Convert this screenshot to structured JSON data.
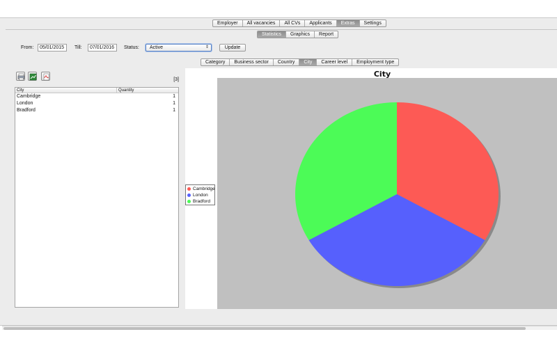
{
  "main_tabs": [
    {
      "label": "Employer",
      "active": false
    },
    {
      "label": "All vacancies",
      "active": false
    },
    {
      "label": "All CVs",
      "active": false
    },
    {
      "label": "Applicants",
      "active": false
    },
    {
      "label": "Extras",
      "active": true
    },
    {
      "label": "Settings",
      "active": false
    }
  ],
  "sub_tabs": [
    {
      "label": "Statistics",
      "active": true
    },
    {
      "label": "Graphics",
      "active": false
    },
    {
      "label": "Report",
      "active": false
    }
  ],
  "filters": {
    "from_label": "From:",
    "from_value": "05/01/2015",
    "till_label": "Till:",
    "till_value": "07/01/2016",
    "status_label": "Status:",
    "status_value": "Active",
    "update_label": "Update"
  },
  "category_tabs": [
    {
      "label": "Category",
      "active": false
    },
    {
      "label": "Business sector",
      "active": false
    },
    {
      "label": "Country",
      "active": false
    },
    {
      "label": "City",
      "active": true
    },
    {
      "label": "Career level",
      "active": false
    },
    {
      "label": "Employment type",
      "active": false
    }
  ],
  "toolbar_icons": [
    "print-icon",
    "export-excel-icon",
    "export-pdf-icon"
  ],
  "result_count": "[3]",
  "table": {
    "headers": [
      "City",
      "Quantity"
    ],
    "rows": [
      {
        "city": "Cambridge",
        "quantity": "1"
      },
      {
        "city": "London",
        "quantity": "1"
      },
      {
        "city": "Bradford",
        "quantity": "1"
      }
    ]
  },
  "chart_data": {
    "type": "pie",
    "title": "City",
    "categories": [
      "Cambridge",
      "London",
      "Bradford"
    ],
    "values": [
      1,
      1,
      1
    ],
    "colors": [
      "#fd5a55",
      "#5660fd",
      "#4cfb57"
    ],
    "legend_position": "left"
  }
}
